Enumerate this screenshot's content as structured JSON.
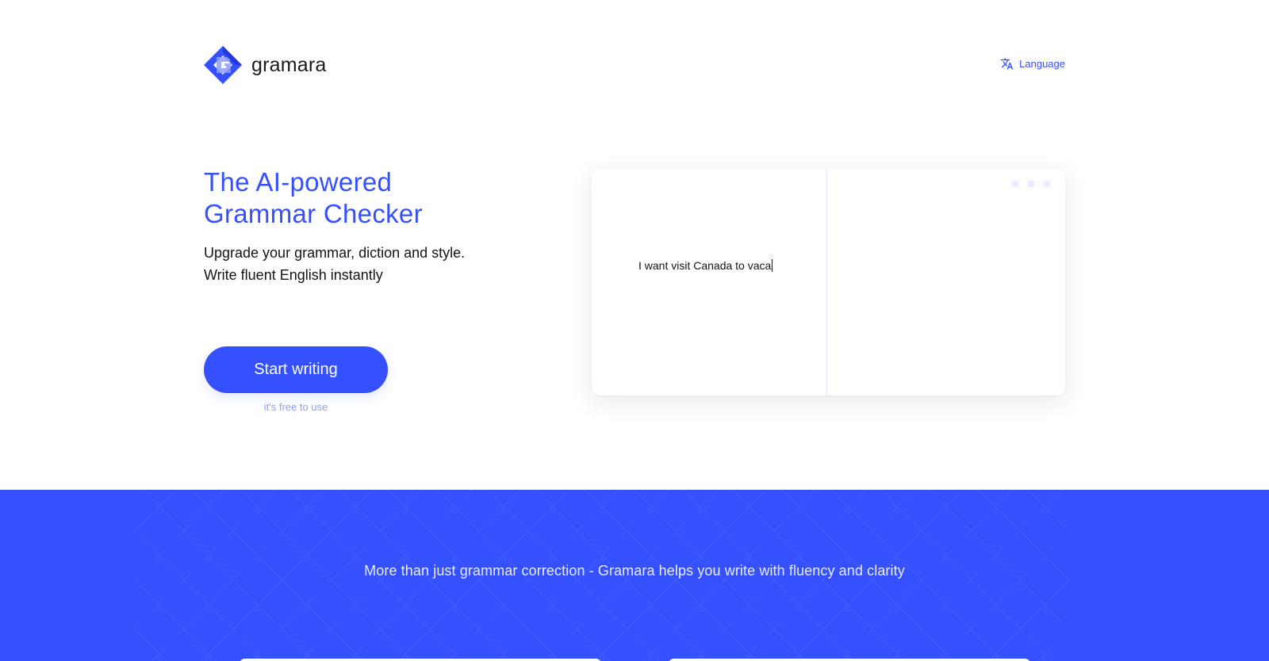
{
  "brand": {
    "name": "gramara",
    "logo_icon": "gramara-logo-icon",
    "accent_color": "#3450ff"
  },
  "header": {
    "language_label": "Language",
    "language_icon": "translate-icon"
  },
  "hero": {
    "title_line1": "The AI-powered",
    "title_line2": "Grammar Checker",
    "subtitle_line1": "Upgrade your grammar, diction and style.",
    "subtitle_line2": "Write fluent English instantly",
    "cta_label": "Start writing",
    "cta_note": "it's free to use"
  },
  "demo_editor": {
    "input_text": "I want visit Canada to vaca"
  },
  "band": {
    "tagline": "More than just grammar correction - Gramara helps you write with fluency and clarity",
    "background_color": "#3450ff"
  }
}
